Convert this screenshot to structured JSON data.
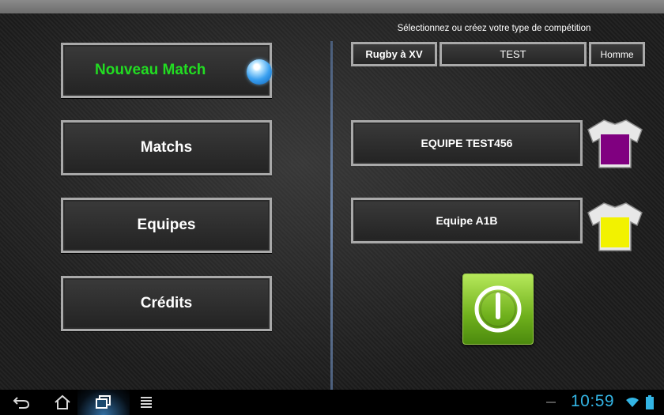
{
  "menu": {
    "new_match": "Nouveau Match",
    "matches": "Matchs",
    "teams": "Equipes",
    "credits": "Crédits"
  },
  "competition": {
    "heading": "Sélectionnez ou créez votre type de compétition",
    "type": "Rugby à XV",
    "name": "TEST",
    "category": "Homme"
  },
  "teams": [
    {
      "name": "EQUIPE TEST456",
      "jersey_color": "#800080"
    },
    {
      "name": "Equipe A1B",
      "jersey_color": "#f2f200"
    }
  ],
  "status_bar": {
    "time": "10:59"
  },
  "colors": {
    "accent_green": "#22dd22",
    "clock_blue": "#33b5e5",
    "power_green": "#6fb01c"
  }
}
